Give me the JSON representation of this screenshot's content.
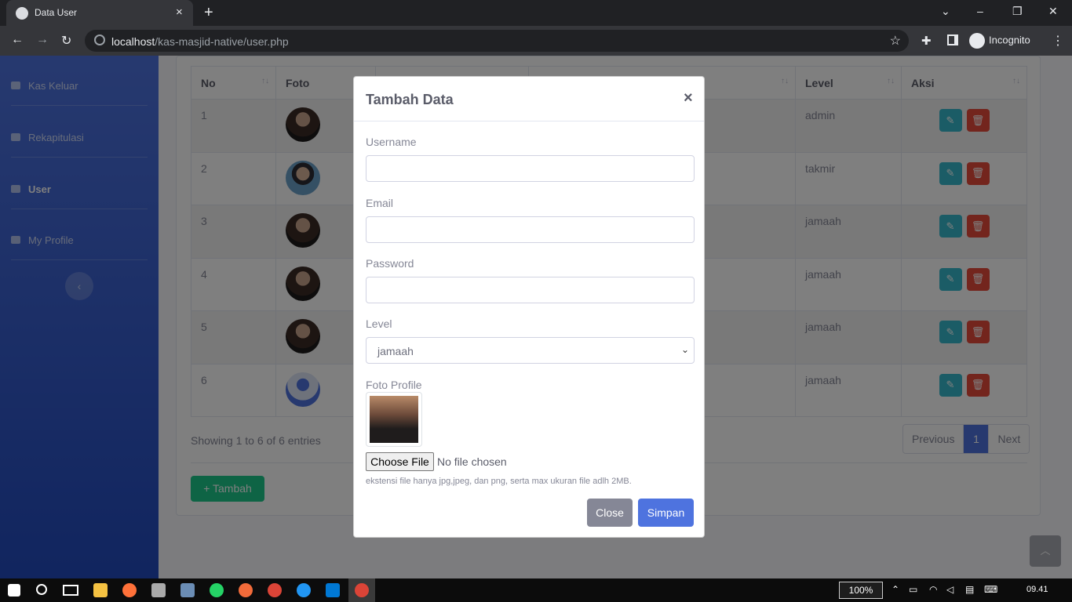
{
  "browser": {
    "tab_title": "Data User",
    "tab_close": "×",
    "new_tab": "+",
    "window_controls": {
      "chevron": "⌄",
      "minimize": "–",
      "restore": "❐",
      "close": "✕"
    },
    "url_host": "localhost",
    "url_path": "/kas-masjid-native/user.php",
    "profile_label": "Incognito",
    "nav": {
      "back": "←",
      "forward": "→",
      "reload": "↻"
    },
    "star": "☆",
    "menu": "⋮"
  },
  "sidebar": {
    "items": [
      {
        "label": "Kas Keluar",
        "icon": "upload-icon",
        "active": false
      },
      {
        "label": "Rekapitulasi",
        "icon": "list-icon",
        "active": false
      },
      {
        "label": "User",
        "icon": "users-icon",
        "active": true
      },
      {
        "label": "My Profile",
        "icon": "user-icon",
        "active": false
      }
    ],
    "toggle": "‹"
  },
  "table": {
    "headers": [
      "No",
      "Foto",
      "",
      "",
      "Level",
      "Aksi"
    ],
    "sort_icon": "↑↓",
    "rows": [
      {
        "no": "1",
        "level": "admin",
        "avatar": "female"
      },
      {
        "no": "2",
        "level": "takmir",
        "avatar": "male"
      },
      {
        "no": "3",
        "level": "jamaah",
        "avatar": "female"
      },
      {
        "no": "4",
        "level": "jamaah",
        "avatar": "female"
      },
      {
        "no": "5",
        "level": "jamaah",
        "avatar": "female"
      },
      {
        "no": "6",
        "level": "jamaah",
        "avatar": "default"
      }
    ]
  },
  "footer": {
    "showing": "Showing 1 to 6 of 6 entries",
    "pager": {
      "previous": "Previous",
      "current": "1",
      "next": "Next"
    },
    "add_button": "+ Tambah",
    "to_top": "︿"
  },
  "modal": {
    "title": "Tambah Data",
    "close_x": "×",
    "username_label": "Username",
    "email_label": "Email",
    "password_label": "Password",
    "level_label": "Level",
    "level_value": "jamaah",
    "select_caret": "⌄",
    "foto_label": "Foto Profile",
    "choose_file": "Choose File",
    "no_file": "No file chosen",
    "hint": "ekstensi file hanya jpg,jpeg, dan png, serta max ukuran file adlh 2MB.",
    "close_button": "Close",
    "save_button": "Simpan"
  },
  "taskbar": {
    "zoom": "100%",
    "time": "09.41",
    "tray_icons": [
      "chevron-up-icon",
      "battery-icon",
      "wifi-icon",
      "volume-icon",
      "notification-icon",
      "keyboard-icon"
    ]
  },
  "colors": {
    "primary": "#4e73df",
    "success": "#1cc88a",
    "info": "#36b9cc",
    "danger": "#e74a3b",
    "secondary": "#858796"
  }
}
